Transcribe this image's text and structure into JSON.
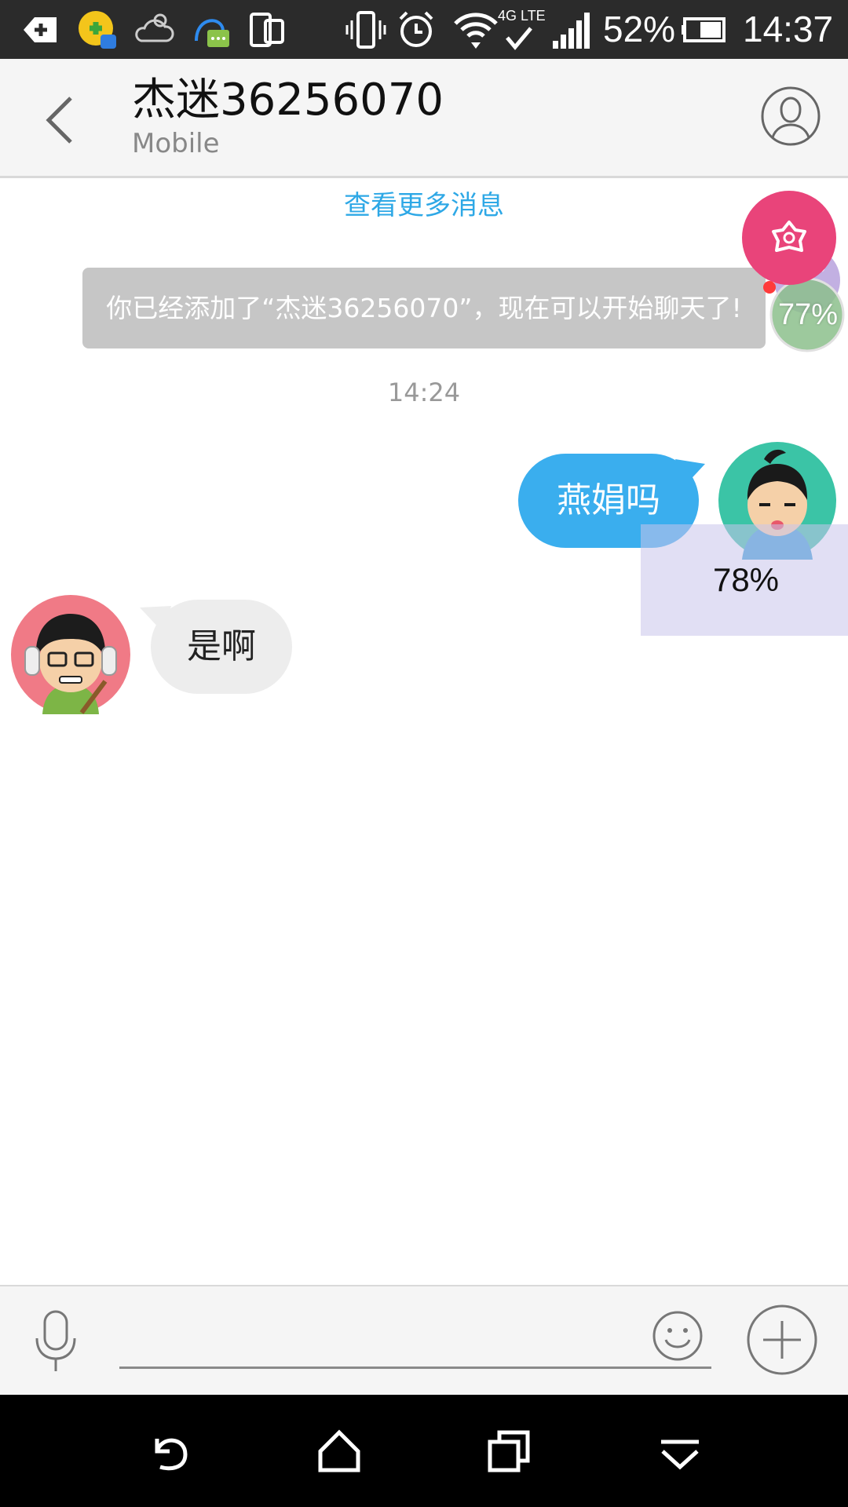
{
  "status_bar": {
    "battery": "52%",
    "time": "14:37",
    "network": "4G LTE",
    "icons": [
      "back-arrow-icon",
      "app-360-icon",
      "weather-cloud-icon",
      "qq-message-icon",
      "dual-screen-icon",
      "vibrate-icon",
      "alarm-icon",
      "wifi-icon",
      "cell-signal-icon",
      "battery-icon"
    ]
  },
  "header": {
    "title": "杰迷36256070",
    "subtitle": "Mobile"
  },
  "chat": {
    "load_more": "查看更多消息",
    "system_notice": "你已经添加了“杰迷36256070”，现在可以开始聊天了!",
    "timestamp": "14:24",
    "messages": [
      {
        "sender": "self",
        "text": "燕娟吗"
      },
      {
        "sender": "peer",
        "text": "是啊"
      }
    ]
  },
  "overlays": {
    "progress_badge": "78%",
    "float_progress": "77%"
  },
  "input": {
    "placeholder": "",
    "value": ""
  },
  "colors": {
    "accent_blue": "#3aaeee",
    "link_blue": "#2ea8e6",
    "float_pink": "#e9447a",
    "status_bar_bg": "#2b2b2b"
  }
}
